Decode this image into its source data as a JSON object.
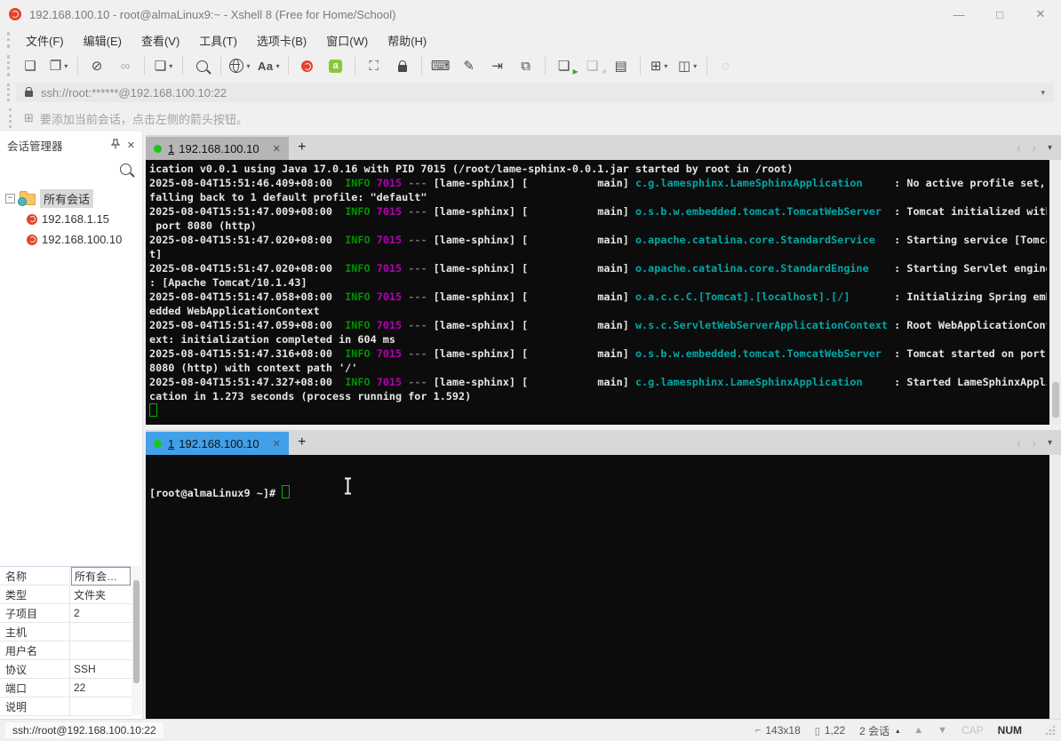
{
  "window": {
    "title": "192.168.100.10 - root@almaLinux9:~ - Xshell 8 (Free for Home/School)"
  },
  "glyphs": {
    "minimize": "—",
    "maximize": "□",
    "close": "✕",
    "plus": "+",
    "minus": "−",
    "back": "‹",
    "forward": "›",
    "down": "▾",
    "up_arrow": "▲",
    "down_arrow": "▼",
    "caret_up": "▴",
    "sel_icon": "⌐",
    "pos_icon": "▯",
    "hint_icon": "⊞"
  },
  "menu": {
    "items": [
      "文件(F)",
      "编辑(E)",
      "查看(V)",
      "工具(T)",
      "选项卡(B)",
      "窗口(W)",
      "帮助(H)"
    ]
  },
  "toolbar": {
    "items": [
      {
        "n": "new-session-button",
        "g": "❏"
      },
      {
        "n": "open-session-button",
        "g": "❐",
        "caret": true
      },
      {
        "sep": true
      },
      {
        "n": "disconnect-button",
        "g": "⊘"
      },
      {
        "n": "reconnect-button",
        "g": "∞",
        "off": true
      },
      {
        "sep": true
      },
      {
        "n": "session-properties-button",
        "g": "❏",
        "caret": true
      },
      {
        "sep": true
      },
      {
        "n": "find-button",
        "css": "mag"
      },
      {
        "sep": true
      },
      {
        "n": "encoding-globe-button",
        "css": "globe",
        "caret": true
      },
      {
        "n": "font-button",
        "g": "Aa",
        "txt": true,
        "caret": true
      },
      {
        "sep": true
      },
      {
        "n": "xshell-button",
        "css": "snail"
      },
      {
        "n": "xftp-button",
        "css": "xftp",
        "label": "a"
      },
      {
        "sep": true
      },
      {
        "n": "fullscreen-button",
        "g": "⛶"
      },
      {
        "n": "lock-screen-button",
        "css": "lockpad"
      },
      {
        "sep": true
      },
      {
        "n": "virtual-keyboard-button",
        "g": "⌨"
      },
      {
        "n": "compose-button",
        "g": "✎"
      },
      {
        "n": "logout-button",
        "g": "⇥"
      },
      {
        "n": "scroll-buffer-button",
        "g": "⧉"
      },
      {
        "sep": true
      },
      {
        "n": "run-script-button",
        "g": "❏",
        "badge": "▶",
        "badge_color": "#2faf2f"
      },
      {
        "n": "stop-script-button",
        "g": "❏",
        "badge": "■",
        "badge_color": "#9a9a9a",
        "off": true
      },
      {
        "n": "log-button",
        "g": "▤"
      },
      {
        "sep": true
      },
      {
        "n": "new-tab-button",
        "g": "⊞",
        "caret": true
      },
      {
        "n": "layout-button",
        "g": "◫",
        "caret": true
      },
      {
        "sep": true
      },
      {
        "n": "chat-button",
        "g": "◌",
        "off": true
      }
    ]
  },
  "address": {
    "value": "ssh://root:******@192.168.100.10:22"
  },
  "hint": {
    "text": "要添加当前会话，点击左侧的箭头按钮。"
  },
  "session_manager": {
    "title": "会话管理器",
    "root_label": "所有会话",
    "sessions": [
      "192.168.1.15",
      "192.168.100.10"
    ]
  },
  "properties": {
    "rows": [
      {
        "label": "名称",
        "value": "所有会…",
        "selected": true
      },
      {
        "label": "类型",
        "value": "文件夹"
      },
      {
        "label": "子项目",
        "value": "2"
      },
      {
        "label": "主机",
        "value": ""
      },
      {
        "label": "用户名",
        "value": ""
      },
      {
        "label": "协议",
        "value": "SSH"
      },
      {
        "label": "端口",
        "value": "22"
      },
      {
        "label": "说明",
        "value": ""
      }
    ]
  },
  "tabs": {
    "pane1": {
      "index": "1",
      "host": "192.168.100.10"
    },
    "pane2": {
      "index": "1",
      "host": "192.168.100.10"
    }
  },
  "terminal1": {
    "lines": [
      [
        [
          "w",
          "ication v0.0.1 using Java 17.0.16 with PID 7015 (/root/lame-sphinx-0.0.1.jar started by root in /root)"
        ]
      ],
      [
        [
          "w",
          "2025-08-04T15:51:46.409+08:00  "
        ],
        [
          "g",
          "INFO"
        ],
        [
          "w",
          " "
        ],
        [
          "m",
          "7015"
        ],
        [
          "d",
          " --- "
        ],
        [
          "w",
          "[lame-sphinx] [           main] "
        ],
        [
          "c",
          "c.g.lamesphinx.LameSphinxApplication"
        ],
        [
          "w",
          "     : No active profile set,"
        ]
      ],
      [
        [
          "w",
          "falling back to 1 default profile: \"default\""
        ]
      ],
      [
        [
          "w",
          "2025-08-04T15:51:47.009+08:00  "
        ],
        [
          "g",
          "INFO"
        ],
        [
          "w",
          " "
        ],
        [
          "m",
          "7015"
        ],
        [
          "d",
          " --- "
        ],
        [
          "w",
          "[lame-sphinx] [           main] "
        ],
        [
          "c",
          "o.s.b.w.embedded.tomcat.TomcatWebServer"
        ],
        [
          "w",
          "  : Tomcat initialized with"
        ]
      ],
      [
        [
          "w",
          " port 8080 (http)"
        ]
      ],
      [
        [
          "w",
          "2025-08-04T15:51:47.020+08:00  "
        ],
        [
          "g",
          "INFO"
        ],
        [
          "w",
          " "
        ],
        [
          "m",
          "7015"
        ],
        [
          "d",
          " --- "
        ],
        [
          "w",
          "[lame-sphinx] [           main] "
        ],
        [
          "c",
          "o.apache.catalina.core.StandardService"
        ],
        [
          "w",
          "   : Starting service [Tomca"
        ]
      ],
      [
        [
          "w",
          "t]"
        ]
      ],
      [
        [
          "w",
          "2025-08-04T15:51:47.020+08:00  "
        ],
        [
          "g",
          "INFO"
        ],
        [
          "w",
          " "
        ],
        [
          "m",
          "7015"
        ],
        [
          "d",
          " --- "
        ],
        [
          "w",
          "[lame-sphinx] [           main] "
        ],
        [
          "c",
          "o.apache.catalina.core.StandardEngine"
        ],
        [
          "w",
          "    : Starting Servlet engine"
        ]
      ],
      [
        [
          "w",
          ": [Apache Tomcat/10.1.43]"
        ]
      ],
      [
        [
          "w",
          "2025-08-04T15:51:47.058+08:00  "
        ],
        [
          "g",
          "INFO"
        ],
        [
          "w",
          " "
        ],
        [
          "m",
          "7015"
        ],
        [
          "d",
          " --- "
        ],
        [
          "w",
          "[lame-sphinx] [           main] "
        ],
        [
          "c",
          "o.a.c.c.C.[Tomcat].[localhost].[/]"
        ],
        [
          "w",
          "       : Initializing Spring emb"
        ]
      ],
      [
        [
          "w",
          "edded WebApplicationContext"
        ]
      ],
      [
        [
          "w",
          "2025-08-04T15:51:47.059+08:00  "
        ],
        [
          "g",
          "INFO"
        ],
        [
          "w",
          " "
        ],
        [
          "m",
          "7015"
        ],
        [
          "d",
          " --- "
        ],
        [
          "w",
          "[lame-sphinx] [           main] "
        ],
        [
          "c",
          "w.s.c.ServletWebServerApplicationContext"
        ],
        [
          "w",
          " : Root WebApplicationCont"
        ]
      ],
      [
        [
          "w",
          "ext: initialization completed in 604 ms"
        ]
      ],
      [
        [
          "w",
          "2025-08-04T15:51:47.316+08:00  "
        ],
        [
          "g",
          "INFO"
        ],
        [
          "w",
          " "
        ],
        [
          "m",
          "7015"
        ],
        [
          "d",
          " --- "
        ],
        [
          "w",
          "[lame-sphinx] [           main] "
        ],
        [
          "c",
          "o.s.b.w.embedded.tomcat.TomcatWebServer"
        ],
        [
          "w",
          "  : Tomcat started on port"
        ]
      ],
      [
        [
          "w",
          "8080 (http) with context path '/'"
        ]
      ],
      [
        [
          "w",
          "2025-08-04T15:51:47.327+08:00  "
        ],
        [
          "g",
          "INFO"
        ],
        [
          "w",
          " "
        ],
        [
          "m",
          "7015"
        ],
        [
          "d",
          " --- "
        ],
        [
          "w",
          "[lame-sphinx] [           main] "
        ],
        [
          "c",
          "c.g.lamesphinx.LameSphinxApplication"
        ],
        [
          "w",
          "     : Started LameSphinxAppli"
        ]
      ],
      [
        [
          "w",
          "cation in 1.273 seconds (process running for 1.592)"
        ]
      ],
      [
        [
          "cur",
          ""
        ]
      ]
    ]
  },
  "terminal2": {
    "prompt": "[root@almaLinux9 ~]# "
  },
  "status": {
    "left": "ssh://root@192.168.100.10:22",
    "size": "143x18",
    "position": "1,22",
    "sessions": "2 会话",
    "cap": "CAP",
    "num": "NUM"
  },
  "colors": {
    "log_info_green": "#009000",
    "log_pid_magenta": "#b400b4",
    "log_logger_cyan": "#00a8a8",
    "log_dim": "#6e6e6e",
    "log_text": "#e6e6e6",
    "cursor_green": "#00b400",
    "tab_active_blue": "#41a0e8",
    "tab_dot_green": "#1ac81a",
    "xshell_red": "#e0452f",
    "xftp_green": "#8cc63e",
    "terminal_bg": "#0c0c0c"
  }
}
